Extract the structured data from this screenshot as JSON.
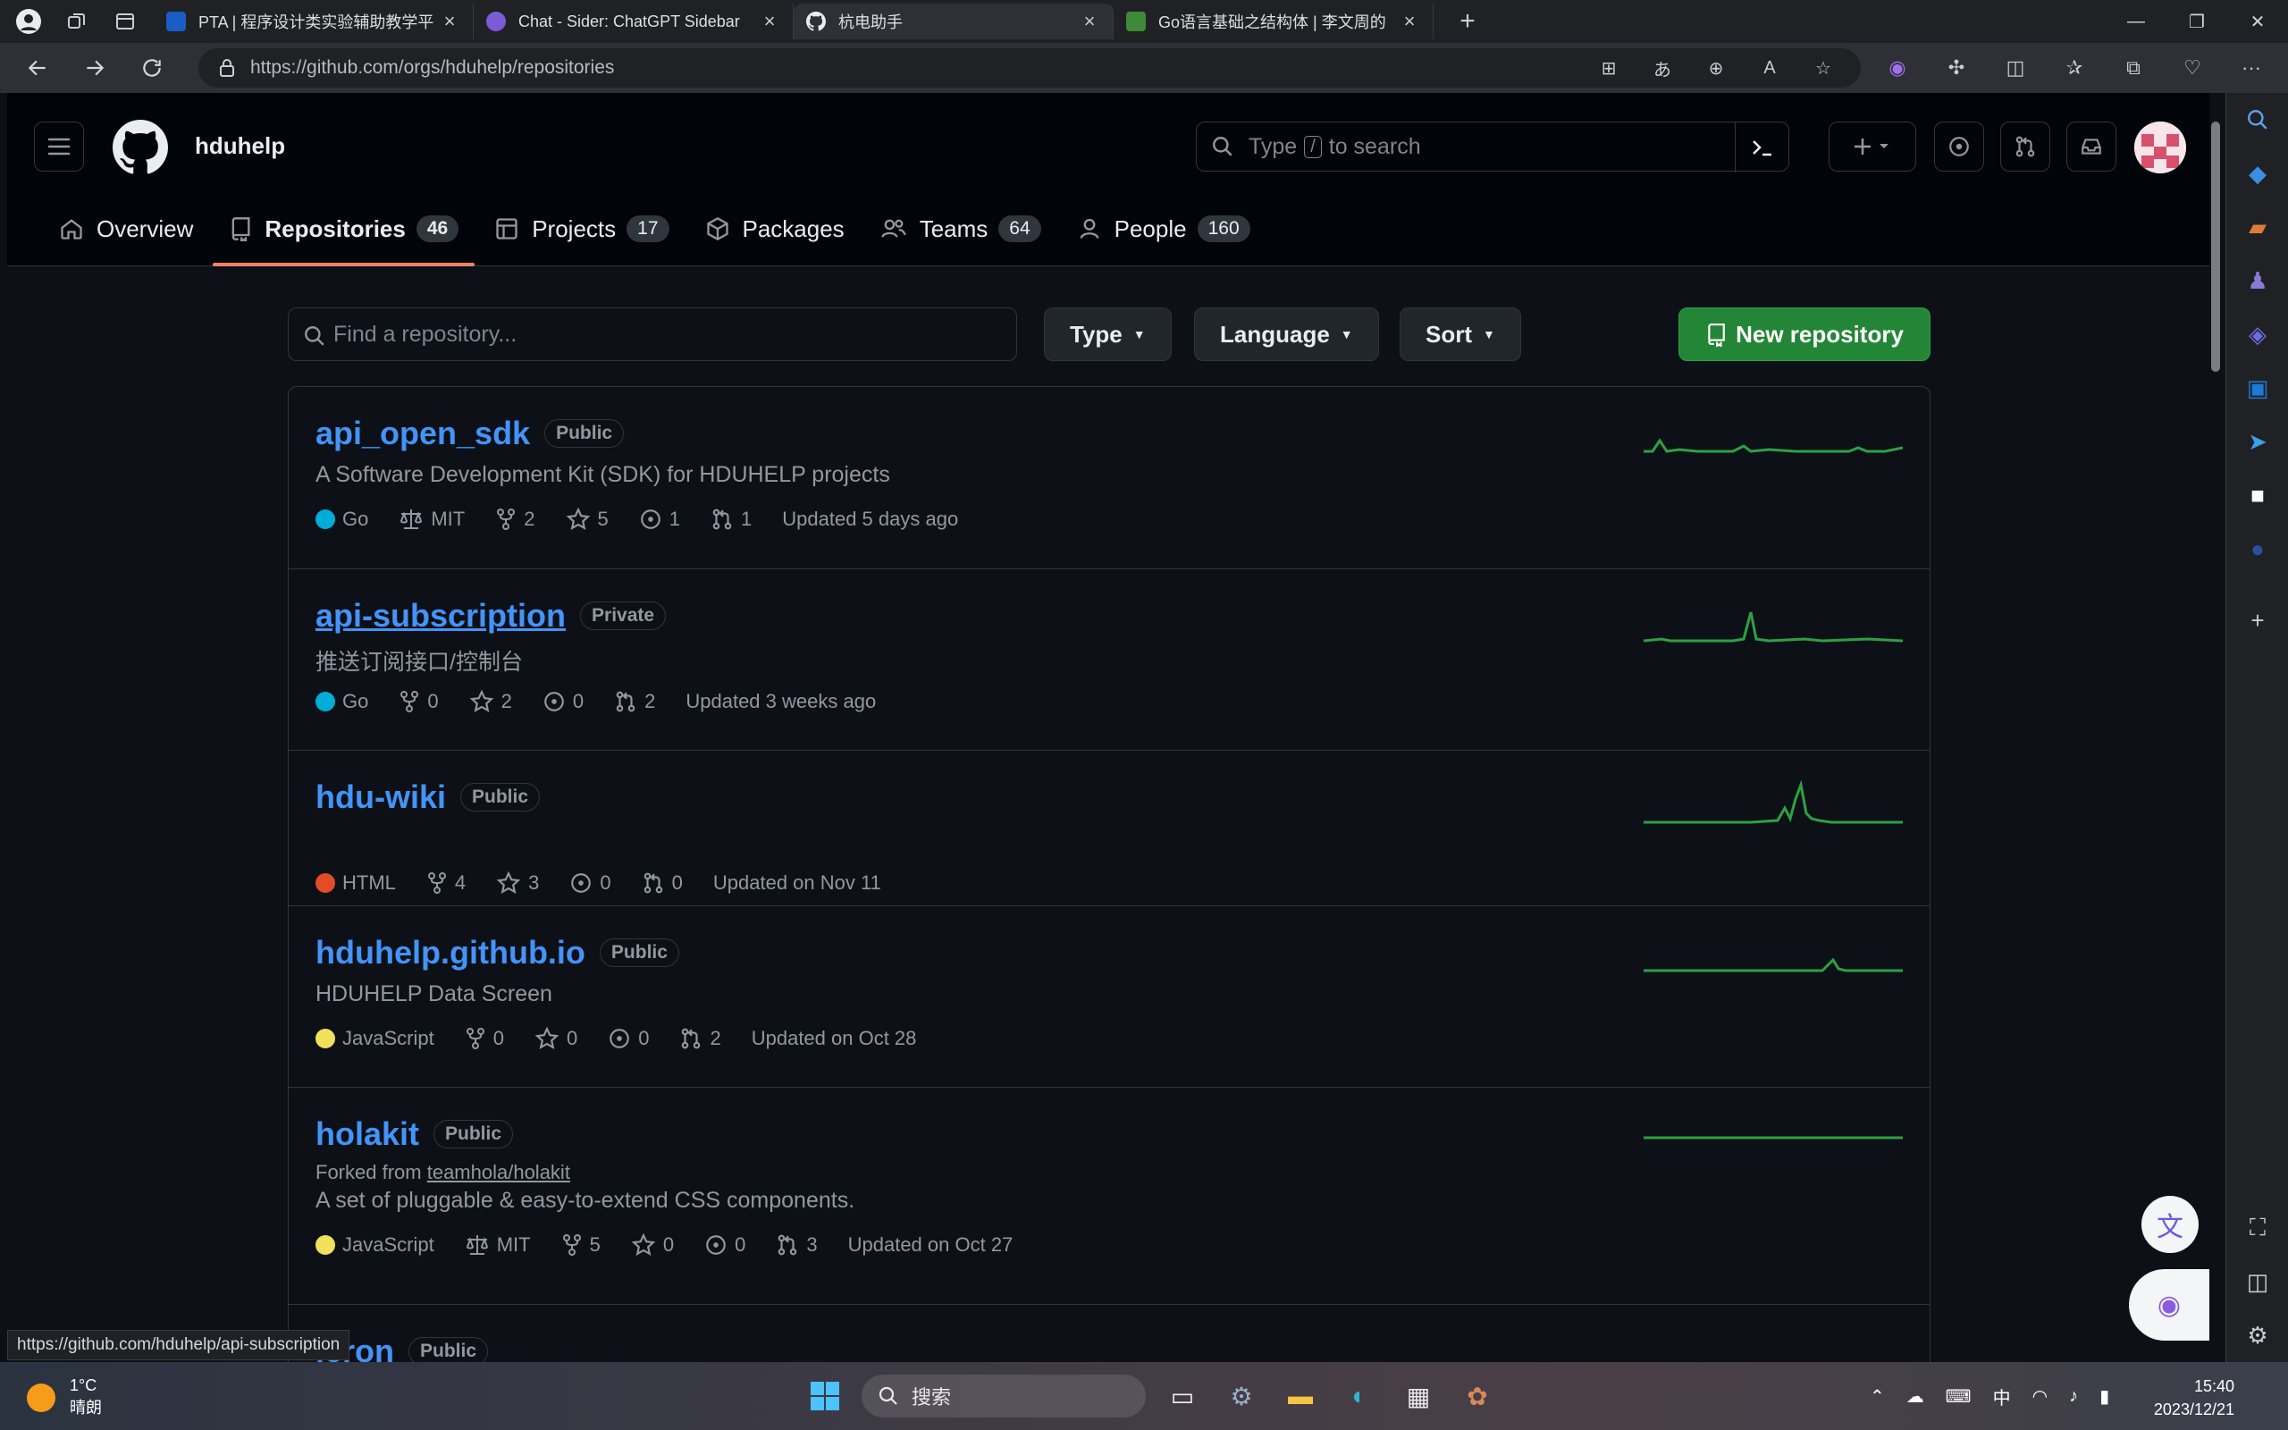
{
  "browser": {
    "tabs": [
      {
        "title": "PTA | 程序设计类实验辅助教学平",
        "fav_color": "#1a5dc4"
      },
      {
        "title": "Chat - Sider: ChatGPT Sidebar",
        "fav_color": "#7b5cd6"
      },
      {
        "title": "杭电助手",
        "fav_color": "#e6edf3"
      },
      {
        "title": "Go语言基础之结构体 | 李文周的",
        "fav_color": "#3d8a3a"
      }
    ],
    "url": "https://github.com/orgs/hduhelp/repositories",
    "status_url": "https://github.com/hduhelp/api-subscription"
  },
  "header": {
    "org_name": "hduhelp",
    "search_prefix": "Type",
    "search_key": "/",
    "search_suffix": "to search"
  },
  "orgnav": [
    {
      "label": "Overview",
      "count": ""
    },
    {
      "label": "Repositories",
      "count": "46"
    },
    {
      "label": "Projects",
      "count": "17"
    },
    {
      "label": "Packages",
      "count": ""
    },
    {
      "label": "Teams",
      "count": "64"
    },
    {
      "label": "People",
      "count": "160"
    }
  ],
  "filters": {
    "find_placeholder": "Find a repository...",
    "type_label": "Type",
    "language_label": "Language",
    "sort_label": "Sort",
    "new_repo_label": "New repository"
  },
  "repos": [
    {
      "name": "api_open_sdk",
      "visibility": "Public",
      "desc": "A Software Development Kit (SDK) for HDUHELP projects",
      "lang": "Go",
      "lang_color": "#00add8",
      "license": "MIT",
      "forks": "2",
      "stars": "5",
      "issues": "1",
      "prs": "1",
      "updated": "Updated 5 days ago"
    },
    {
      "name": "api-subscription",
      "visibility": "Private",
      "desc": "推送订阅接口/控制台",
      "lang": "Go",
      "lang_color": "#00add8",
      "license": "",
      "forks": "0",
      "stars": "2",
      "issues": "0",
      "prs": "2",
      "updated": "Updated 3 weeks ago"
    },
    {
      "name": "hdu-wiki",
      "visibility": "Public",
      "desc": "",
      "lang": "HTML",
      "lang_color": "#e34c26",
      "license": "",
      "forks": "4",
      "stars": "3",
      "issues": "0",
      "prs": "0",
      "updated": "Updated on Nov 11"
    },
    {
      "name": "hduhelp.github.io",
      "visibility": "Public",
      "desc": "HDUHELP Data Screen",
      "lang": "JavaScript",
      "lang_color": "#f1e05a",
      "license": "",
      "forks": "0",
      "stars": "0",
      "issues": "0",
      "prs": "2",
      "updated": "Updated on Oct 28"
    },
    {
      "name": "holakit",
      "visibility": "Public",
      "forked_prefix": "Forked from",
      "forked_from": "teamhola/holakit",
      "desc": "A set of pluggable & easy-to-extend CSS components.",
      "lang": "JavaScript",
      "lang_color": "#f1e05a",
      "license": "MIT",
      "forks": "5",
      "stars": "0",
      "issues": "0",
      "prs": "3",
      "updated": "Updated on Oct 27"
    },
    {
      "name": "icron",
      "visibility": "Public"
    }
  ],
  "taskbar": {
    "temp": "1°C",
    "weather": "晴朗",
    "search_label": "搜索",
    "ime": "中",
    "time": "15:40",
    "date": "2023/12/21"
  }
}
